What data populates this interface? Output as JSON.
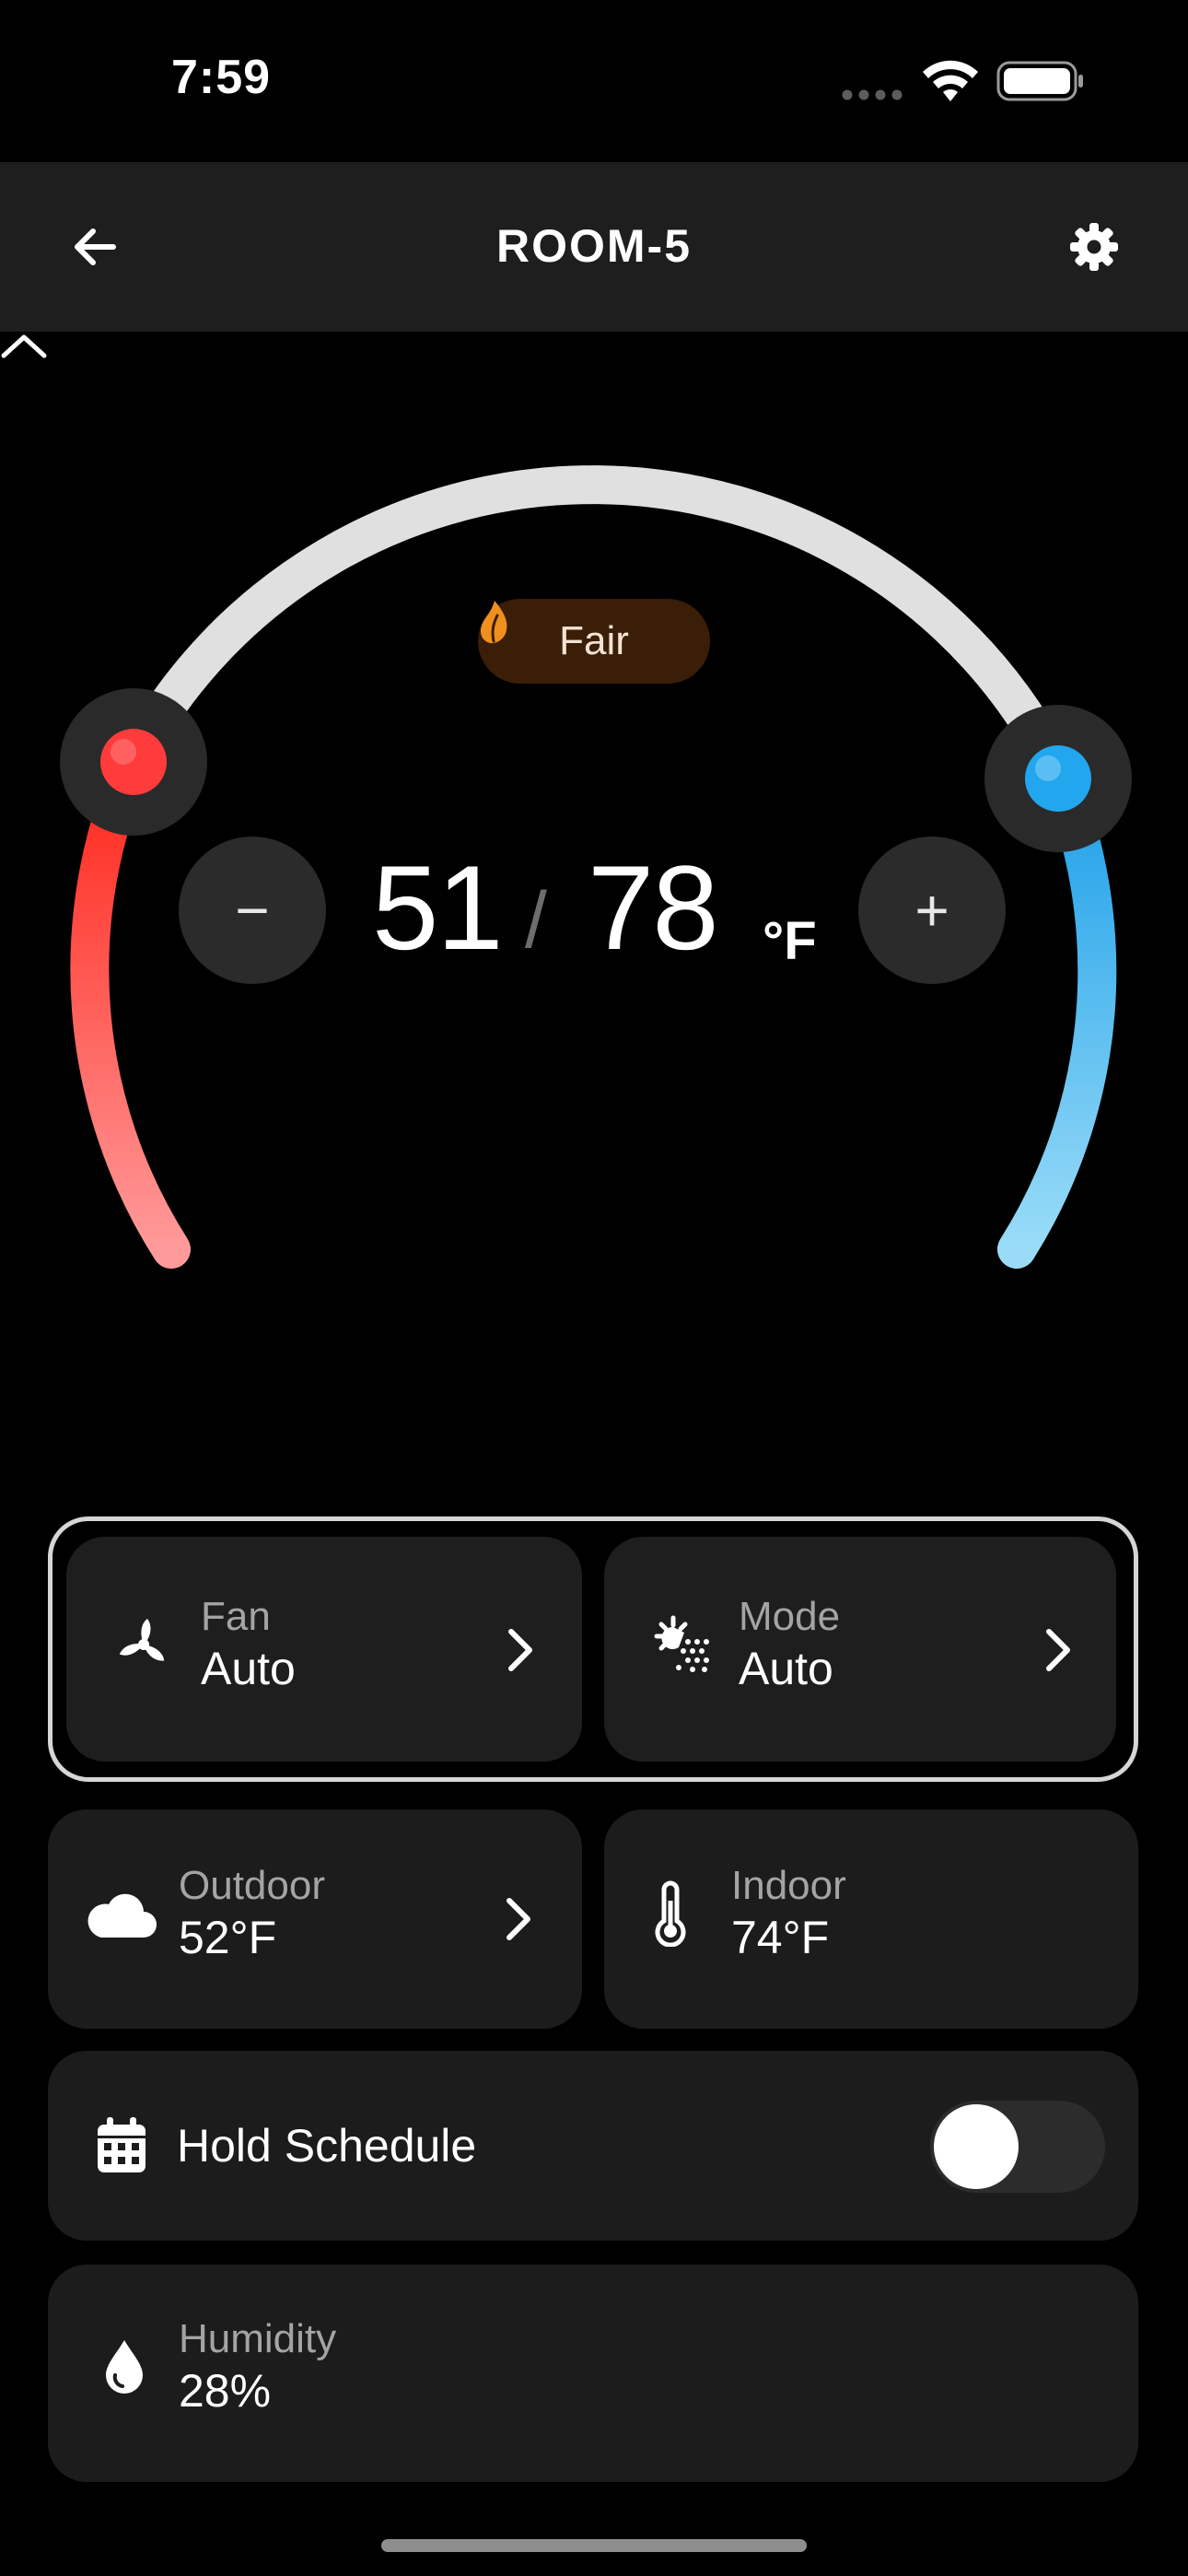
{
  "status_bar": {
    "time": "7:59"
  },
  "header": {
    "title": "ROOM-5"
  },
  "dial": {
    "air_quality": "Fair",
    "heat_setpoint": "51",
    "cool_setpoint": "78",
    "separator": "/",
    "unit": "°F",
    "minus_label": "−",
    "plus_label": "+",
    "heat_color": "#ff2d2d",
    "cool_color": "#1a9fe8",
    "track_color": "#e0e0e0"
  },
  "fan": {
    "label": "Fan",
    "value": "Auto"
  },
  "mode": {
    "label": "Mode",
    "value": "Auto"
  },
  "outdoor": {
    "label": "Outdoor",
    "value": "52°F"
  },
  "indoor": {
    "label": "Indoor",
    "value": "74°F"
  },
  "hold_schedule": {
    "label": "Hold Schedule",
    "enabled": false
  },
  "humidity": {
    "label": "Humidity",
    "value": "28%"
  },
  "icons": {
    "back": "arrow-left-icon",
    "settings": "gear-icon",
    "air_quality": "leaf-icon",
    "fan": "fan-icon",
    "mode": "sun-snow-icon",
    "outdoor": "cloud-icon",
    "indoor": "thermometer-icon",
    "hold": "calendar-icon",
    "humidity": "droplet-icon"
  }
}
